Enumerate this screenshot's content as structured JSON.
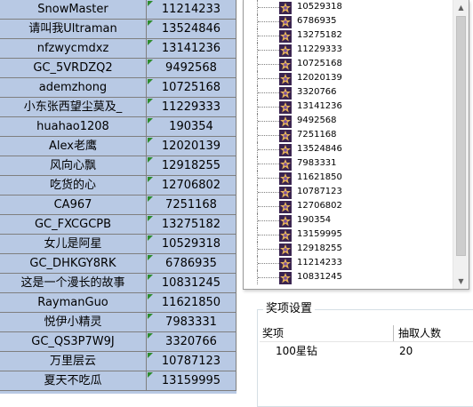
{
  "left_table": {
    "rows": [
      {
        "name": "SnowMaster",
        "id": "11214233"
      },
      {
        "name": "请叫我Ultraman",
        "id": "13524846"
      },
      {
        "name": "nfzwycmdxz",
        "id": "13141236"
      },
      {
        "name": "GC_5VRDZQ2",
        "id": "9492568"
      },
      {
        "name": "ademzhong",
        "id": "10725168"
      },
      {
        "name": "小东张西望尘莫及_",
        "id": "11229333"
      },
      {
        "name": "huahao1208",
        "id": "190354"
      },
      {
        "name": "Alex老鹰",
        "id": "12020139"
      },
      {
        "name": "风向心飘",
        "id": "12918255"
      },
      {
        "name": "吃货的心",
        "id": "12706802"
      },
      {
        "name": "CA967",
        "id": "7251168"
      },
      {
        "name": "GC_FXCGCPB",
        "id": "13275182"
      },
      {
        "name": "女儿是阿星",
        "id": "10529318"
      },
      {
        "name": "GC_DHKGY8RK",
        "id": "6786935"
      },
      {
        "name": "这是一个漫长的故事",
        "id": "10831245"
      },
      {
        "name": "RaymanGuo",
        "id": "11621850"
      },
      {
        "name": "悦伊小精灵",
        "id": "7983331"
      },
      {
        "name": "GC_QS3P7W9J",
        "id": "3320766"
      },
      {
        "name": "万里层云",
        "id": "10787123"
      },
      {
        "name": "夏天不吃瓜",
        "id": "13159995"
      }
    ]
  },
  "tree": {
    "items": [
      "10529318",
      "6786935",
      "13275182",
      "11229333",
      "10725168",
      "12020139",
      "3320766",
      "13141236",
      "9492568",
      "7251168",
      "13524846",
      "7983331",
      "11621850",
      "10787123",
      "12706802",
      "190354",
      "13159995",
      "12918255",
      "11214233",
      "10831245"
    ]
  },
  "prize_settings": {
    "title": "奖项设置",
    "columns": [
      "奖项",
      "抽取人数"
    ],
    "rows": [
      {
        "prize": "100星钻",
        "count": "20"
      }
    ]
  },
  "colors": {
    "table_bg": "#b8c9e4",
    "cell_marker": "#2e8b2e"
  }
}
